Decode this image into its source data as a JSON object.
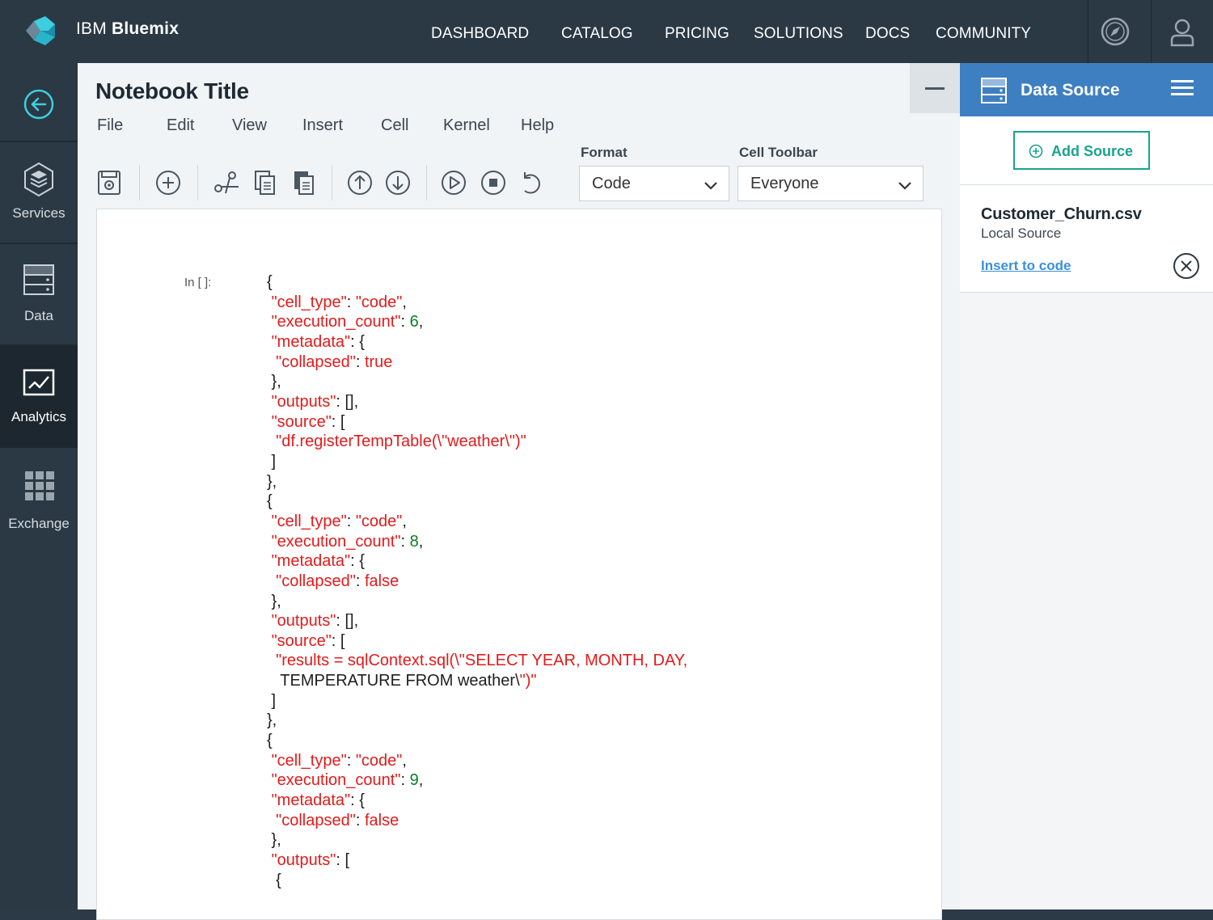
{
  "app": {
    "brand_ibm": "IBM",
    "brand_name": "Bluemix"
  },
  "topnav": [
    "DASHBOARD",
    "CATALOG",
    "PRICING",
    "SOLUTIONS",
    "DOCS",
    "COMMUNITY"
  ],
  "sidebar": [
    {
      "label": "Services",
      "icon": "layers-icon"
    },
    {
      "label": "Data",
      "icon": "server-icon"
    },
    {
      "label": "Analytics",
      "icon": "chart-icon",
      "active": true
    },
    {
      "label": "Exchange",
      "icon": "grid-icon"
    }
  ],
  "notebook": {
    "title": "Notebook Title",
    "menu": [
      "File",
      "Edit",
      "View",
      "Insert",
      "Cell",
      "Kernel",
      "Help"
    ],
    "format_label": "Format",
    "format_value": "Code",
    "cell_toolbar_label": "Cell Toolbar",
    "cell_toolbar_value": "Everyone",
    "prompt": "In [ ]:",
    "code_lines": [
      "{",
      " \"cell_type\": \"code\",",
      " \"execution_count\": 6,",
      " \"metadata\": {",
      "  \"collapsed\": true",
      " },",
      " \"outputs\": [],",
      " \"source\": [",
      "  \"df.registerTempTable(\\\"weather\\\")\"",
      " ]",
      "},",
      "{",
      " \"cell_type\": \"code\",",
      " \"execution_count\": 8,",
      " \"metadata\": {",
      "  \"collapsed\": false",
      " },",
      " \"outputs\": [],",
      " \"source\": [",
      "  \"results = sqlContext.sql(\\\"SELECT YEAR, MONTH, DAY,",
      "   TEMPERATURE FROM weather\\\")\"",
      " ]",
      "},",
      "{",
      " \"cell_type\": \"code\",",
      " \"execution_count\": 9,",
      " \"metadata\": {",
      "  \"collapsed\": false",
      " },",
      " \"outputs\": [",
      "  {"
    ]
  },
  "data_source_panel": {
    "title": "Data Source",
    "add_button": "Add Source",
    "source": {
      "name": "Customer_Churn.csv",
      "type": "Local Source",
      "link": "Insert to code"
    }
  },
  "colors": {
    "topbar": "#2b3944",
    "accent_teal": "#19a38f",
    "panel_header": "#3e7fc1",
    "code_string": "#e21b1b",
    "code_number": "#0b7f1f",
    "link": "#3a8fe0"
  }
}
